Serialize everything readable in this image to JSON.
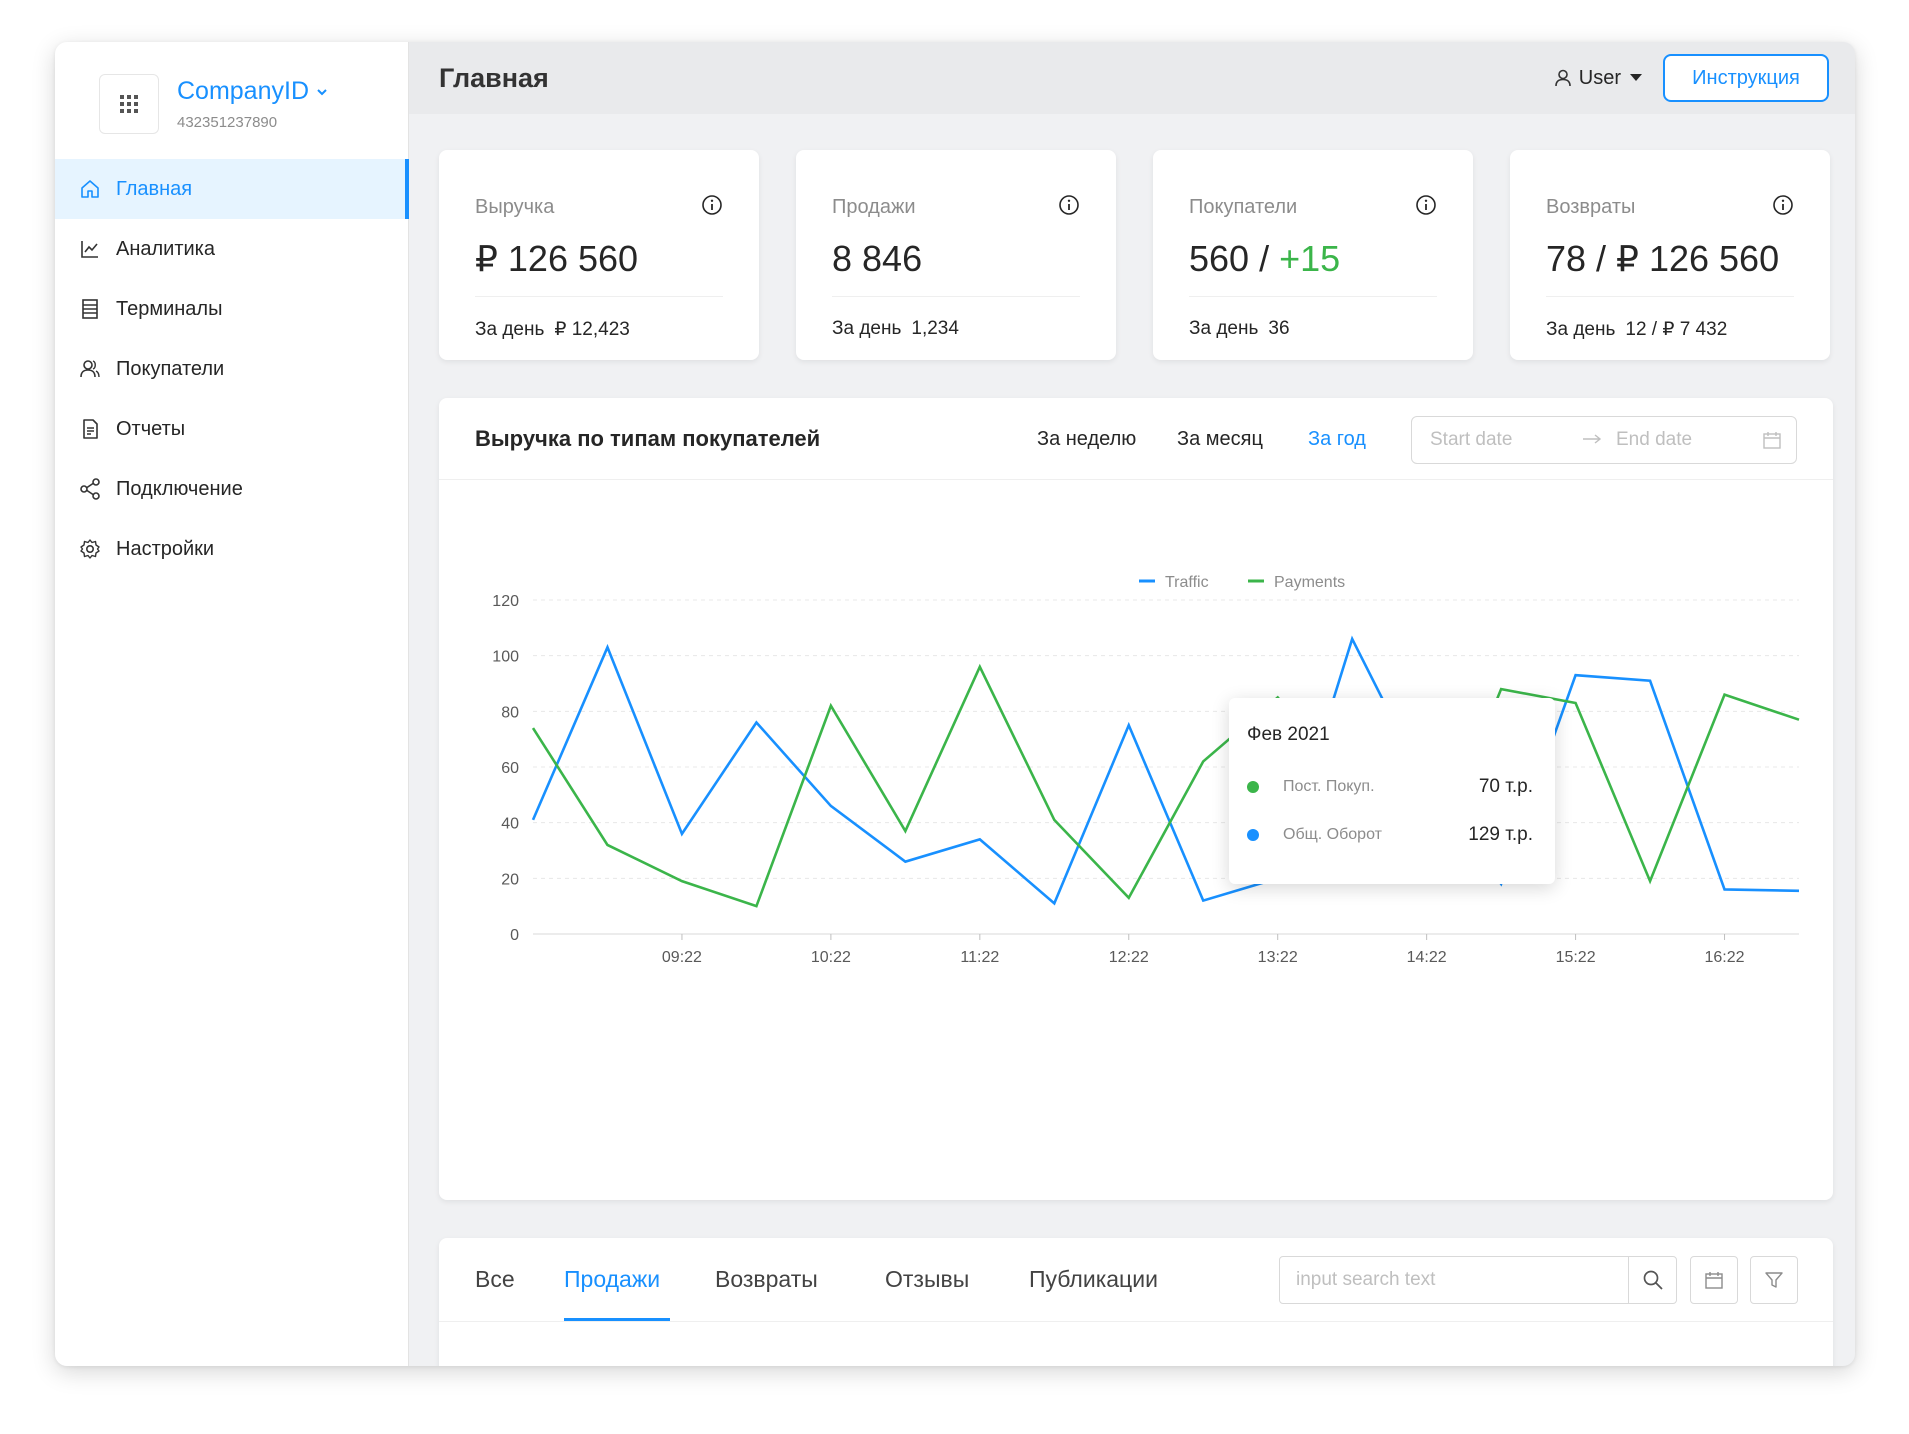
{
  "app": {
    "company_name": "CompanyID",
    "company_id": "432351237890",
    "page_title": "Главная",
    "user_label": "User",
    "help_button": "Инструкция"
  },
  "sidebar": {
    "items": [
      {
        "label": "Главная",
        "icon": "home-icon",
        "active": true
      },
      {
        "label": "Аналитика",
        "icon": "line-chart-icon",
        "active": false
      },
      {
        "label": "Терминалы",
        "icon": "terminal-icon",
        "active": false
      },
      {
        "label": "Покупатели",
        "icon": "users-icon",
        "active": false
      },
      {
        "label": "Отчеты",
        "icon": "report-icon",
        "active": false
      },
      {
        "label": "Подключение",
        "icon": "share-icon",
        "active": false
      },
      {
        "label": "Настройки",
        "icon": "gear-icon",
        "active": false
      }
    ]
  },
  "stats": [
    {
      "label": "Выручка",
      "value": "₽ 126 560",
      "foot_label": "За день",
      "foot_value": "₽ 12,423"
    },
    {
      "label": "Продажи",
      "value": "8 846",
      "foot_label": "За день",
      "foot_value": "1,234"
    },
    {
      "label": "Покупатели",
      "value": "560 / ",
      "value_accent": "+15",
      "foot_label": "За день",
      "foot_value": "36"
    },
    {
      "label": "Возвраты",
      "value": "78 / ₽ 126 560",
      "foot_label": "За день",
      "foot_value": "12 / ₽ 7 432"
    }
  ],
  "revenue_panel": {
    "title": "Выручка по типам покупателей",
    "periods": [
      "За неделю",
      "За месяц",
      "За год"
    ],
    "active_period": "За год",
    "range_start_placeholder": "Start date",
    "range_end_placeholder": "End date",
    "tooltip": {
      "title": "Фев 2021",
      "rows": [
        {
          "name": "Пост. Покуп.",
          "value": "70 т.р.",
          "color": "#3bb54a"
        },
        {
          "name": "Общ. Оборот",
          "value": "129 т.р.",
          "color": "#1890ff"
        }
      ]
    }
  },
  "chart_data": {
    "type": "line",
    "title": "",
    "xlabel": "",
    "ylabel": "",
    "ylim": [
      0,
      120
    ],
    "yticks": [
      0,
      20,
      40,
      60,
      80,
      100,
      120
    ],
    "x": [
      0,
      1,
      2,
      3,
      4,
      5,
      6,
      7,
      8,
      9,
      10,
      11,
      12,
      13,
      14,
      15,
      16,
      17
    ],
    "xtick_positions": [
      2,
      4,
      6,
      8,
      10,
      12,
      14,
      16
    ],
    "xtick_labels": [
      "09:22",
      "10:22",
      "11:22",
      "12:22",
      "13:22",
      "14:22",
      "15:22",
      "16:22"
    ],
    "legend_position": "top-center",
    "grid": true,
    "series": [
      {
        "name": "Traffic",
        "color": "#1890ff",
        "values": [
          41,
          103,
          36,
          76,
          46,
          26,
          34,
          11,
          75,
          12,
          20,
          106,
          53,
          18,
          93,
          91,
          16,
          15.5
        ]
      },
      {
        "name": "Payments",
        "color": "#3bb54a",
        "values": [
          74,
          32,
          19,
          10,
          82,
          37,
          96,
          41,
          13,
          62,
          85,
          54,
          22,
          88,
          83,
          19,
          86,
          77
        ]
      }
    ]
  },
  "bottom_panel": {
    "tabs": [
      "Все",
      "Продажи",
      "Возвраты",
      "Отзывы",
      "Публикации"
    ],
    "active_tab": "Продажи",
    "search_placeholder": "input search text"
  }
}
